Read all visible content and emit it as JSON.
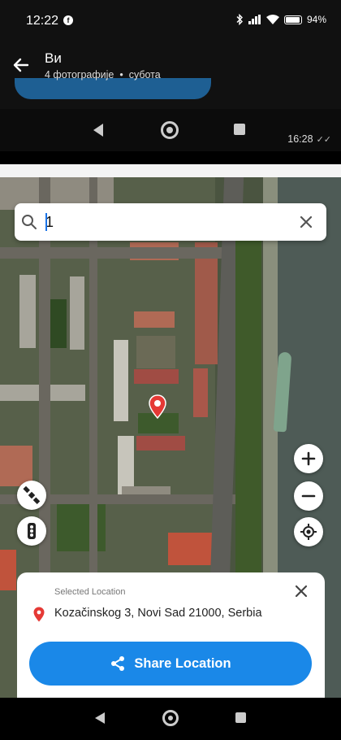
{
  "status_bar": {
    "time": "12:22",
    "app_icon": "facebook-icon",
    "battery": "94%",
    "icons": [
      "bluetooth-icon",
      "signal-icon",
      "wifi-icon",
      "battery-icon"
    ]
  },
  "viewer": {
    "title": "Ви",
    "subtitle_count": "4 фотографије",
    "subtitle_separator": "•",
    "subtitle_day": "субота",
    "message_time": "16:28",
    "message_ticks": "✓✓"
  },
  "map": {
    "search": {
      "value": "1",
      "placeholder": ""
    },
    "controls": [
      "zoom-in",
      "zoom-out",
      "locate",
      "map-layers",
      "traffic"
    ],
    "zoom_in_label": "+",
    "zoom_out_label": "−"
  },
  "sheet": {
    "label": "Selected Location",
    "address": "Kozačinskog 3, Novi Sad 21000, Serbia",
    "share_label": "Share Location"
  },
  "colors": {
    "accent": "#1a88e8",
    "pin": "#e53935"
  }
}
